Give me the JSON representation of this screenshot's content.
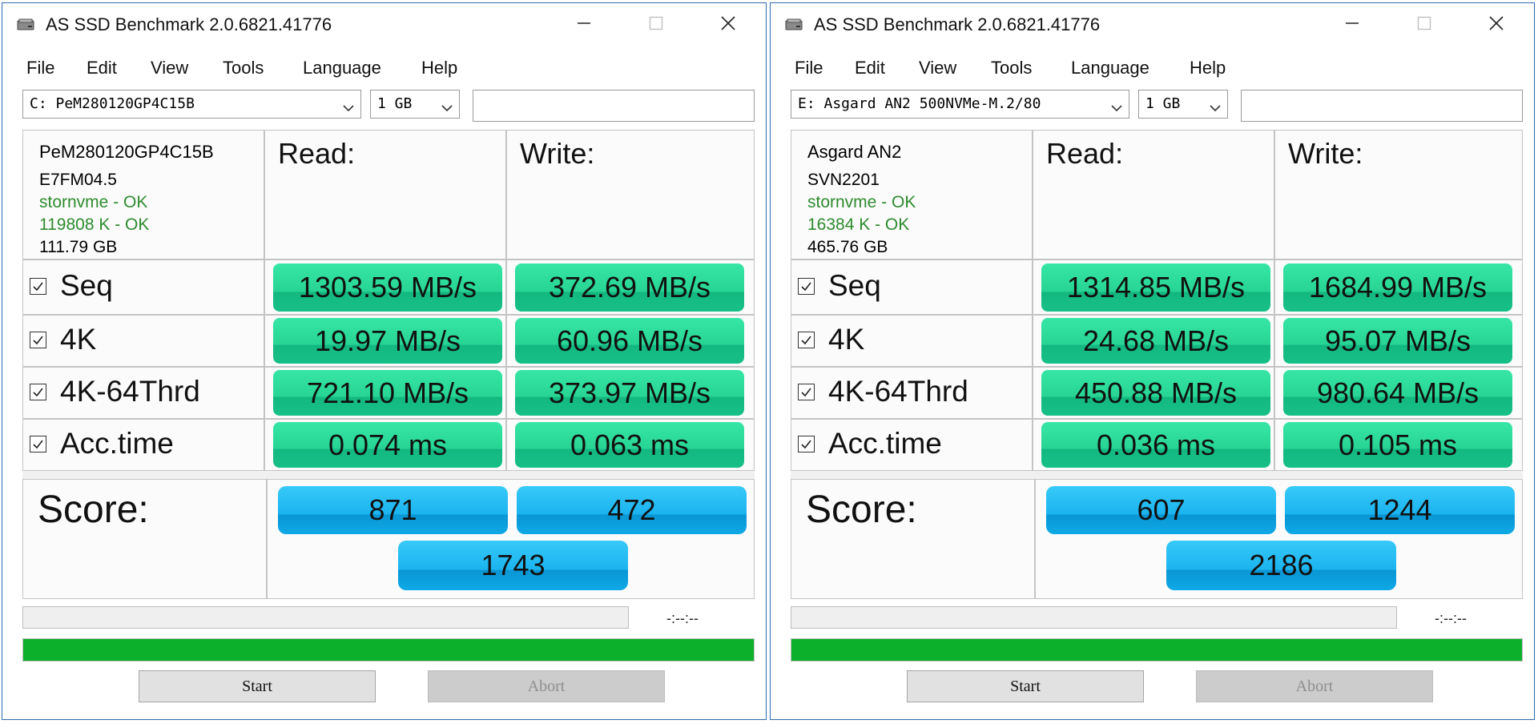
{
  "windows": [
    {
      "title": "AS SSD Benchmark 2.0.6821.41776",
      "menu": [
        "File",
        "Edit",
        "View",
        "Tools",
        "Language",
        "Help"
      ],
      "drive": "C: PeM280120GP4C15B",
      "size": "1 GB",
      "info": {
        "model": "PeM280120GP4C15B",
        "firmware": "E7FM04.5",
        "driver": "stornvme - OK",
        "alignment": "119808 K - OK",
        "capacity": "111.79 GB"
      },
      "columns": {
        "read": "Read:",
        "write": "Write:"
      },
      "rows": [
        {
          "label": "Seq",
          "read": "1303.59 MB/s",
          "write": "372.69 MB/s"
        },
        {
          "label": "4K",
          "read": "19.97 MB/s",
          "write": "60.96 MB/s"
        },
        {
          "label": "4K-64Thrd",
          "read": "721.10 MB/s",
          "write": "373.97 MB/s"
        },
        {
          "label": "Acc.time",
          "read": "0.074 ms",
          "write": "0.063 ms"
        }
      ],
      "score": {
        "label": "Score:",
        "read": "871",
        "write": "472",
        "total": "1743"
      },
      "time": "-:--:--",
      "progress": 1.0,
      "buttons": {
        "start": "Start",
        "abort": "Abort"
      }
    },
    {
      "title": "AS SSD Benchmark 2.0.6821.41776",
      "menu": [
        "File",
        "Edit",
        "View",
        "Tools",
        "Language",
        "Help"
      ],
      "drive": "E: Asgard AN2 500NVMe-M.2/80",
      "size": "1 GB",
      "info": {
        "model": "Asgard AN2",
        "firmware": "SVN2201",
        "driver": "stornvme - OK",
        "alignment": "16384 K - OK",
        "capacity": "465.76 GB"
      },
      "columns": {
        "read": "Read:",
        "write": "Write:"
      },
      "rows": [
        {
          "label": "Seq",
          "read": "1314.85 MB/s",
          "write": "1684.99 MB/s"
        },
        {
          "label": "4K",
          "read": "24.68 MB/s",
          "write": "95.07 MB/s"
        },
        {
          "label": "4K-64Thrd",
          "read": "450.88 MB/s",
          "write": "980.64 MB/s"
        },
        {
          "label": "Acc.time",
          "read": "0.036 ms",
          "write": "0.105 ms"
        }
      ],
      "score": {
        "label": "Score:",
        "read": "607",
        "write": "1244",
        "total": "2186"
      },
      "time": "-:--:--",
      "progress": 1.0,
      "buttons": {
        "start": "Start",
        "abort": "Abort"
      }
    }
  ],
  "icons": {
    "app": "drive-icon",
    "minimize": "minimize-icon",
    "maximize": "maximize-icon",
    "close": "close-icon",
    "dropdown": "chevron-down-icon",
    "checkbox": "check-icon"
  },
  "colors": {
    "result_green": "#27d494",
    "score_blue": "#1bb4f0",
    "progress_green": "#0cb02a",
    "ok_text": "#2e8b2e"
  }
}
